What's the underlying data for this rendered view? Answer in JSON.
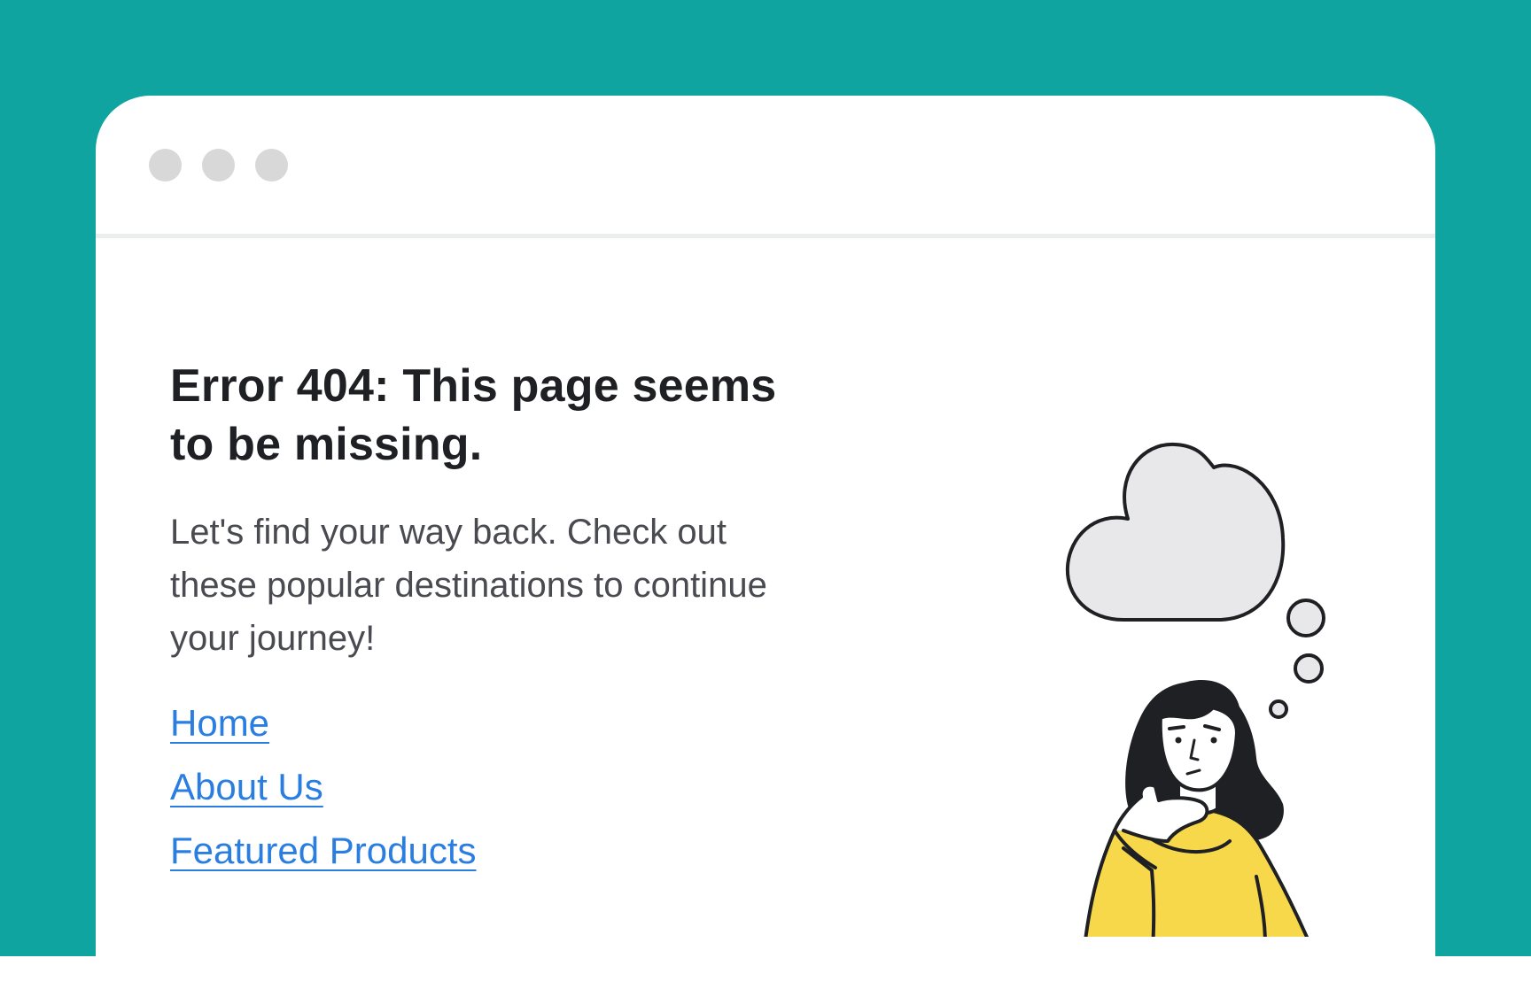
{
  "colors": {
    "background": "#0fa4a0",
    "window": "#ffffff",
    "window_dots": "#d8d8d9",
    "heading": "#1f2024",
    "body_text": "#4a4b50",
    "link": "#2a7de1",
    "cloud_fill": "#e8e8ea",
    "sweater": "#f6d84a",
    "desk": "#f58a4b",
    "outline": "#1f2024"
  },
  "error_page": {
    "heading": "Error 404: This page seems to be missing.",
    "message": "Let's find your way back. Check out these popular destinations to continue your journey!",
    "links": [
      {
        "label": "Home"
      },
      {
        "label": "About Us"
      },
      {
        "label": "Featured Products"
      }
    ]
  },
  "illustration": {
    "icon": "thinking-person-icon",
    "thought": "cloud-icon"
  }
}
